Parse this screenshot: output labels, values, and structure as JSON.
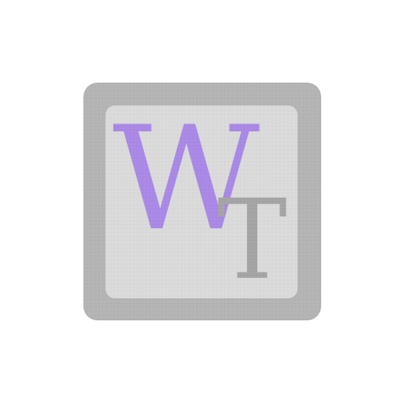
{
  "logo": {
    "letter_primary": "W",
    "letter_secondary": "T",
    "colors": {
      "outer_frame": "#b4b4b4",
      "inner_panel": "#dadada",
      "primary_letter": "#a988e6",
      "secondary_letter": "#a4a4a4",
      "background": "#ffffff"
    }
  }
}
